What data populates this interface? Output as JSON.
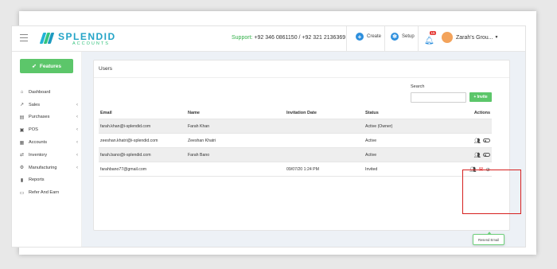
{
  "header": {
    "brand_name": "SPLENDID",
    "brand_sub": "ACCOUNTS",
    "support_label": "Support:",
    "support_numbers": "+92 346 0861150 / +92 321 2136369",
    "create_label": "Create",
    "setup_label": "Setup",
    "notification_count": "15",
    "org_name": "Zarah's Grou...",
    "icons": [
      "menu-icon",
      "plus-icon",
      "gear-icon",
      "bell-icon",
      "chevron-down-icon"
    ]
  },
  "sidebar": {
    "features_label": "Features",
    "items": [
      {
        "label": "Dashboard",
        "icon": "home-icon",
        "has_chevron": false
      },
      {
        "label": "Sales",
        "icon": "chart-icon",
        "has_chevron": true
      },
      {
        "label": "Purchases",
        "icon": "cart-icon",
        "has_chevron": true
      },
      {
        "label": "POS",
        "icon": "pos-icon",
        "has_chevron": true
      },
      {
        "label": "Accounts",
        "icon": "accounts-icon",
        "has_chevron": true
      },
      {
        "label": "Inventory",
        "icon": "inventory-icon",
        "has_chevron": true
      },
      {
        "label": "Manufacturing",
        "icon": "manufacturing-icon",
        "has_chevron": true
      },
      {
        "label": "Reports",
        "icon": "reports-icon",
        "has_chevron": false
      },
      {
        "label": "Refer And Earn",
        "icon": "refer-icon",
        "has_chevron": false
      }
    ]
  },
  "users": {
    "title": "Users",
    "search_label": "Search",
    "search_value": "",
    "invite_label": "+ Invite",
    "columns": [
      "Email",
      "Name",
      "Invitation Date",
      "Status",
      "Actions"
    ],
    "rows": [
      {
        "email": "farah.khan@i-splendid.com",
        "name": "Farah Khan",
        "date": "",
        "status": "Active (Owner)"
      },
      {
        "email": "zeeshan.khatri@i-splendid.com",
        "name": "Zeeshan Khatri",
        "date": "",
        "status": "Active"
      },
      {
        "email": "farah.bano@i-splendid.com",
        "name": "Farah Bano",
        "date": "",
        "status": "Active"
      },
      {
        "email": "farahbano77@gmail.com",
        "name": "",
        "date": "09/07/20 1:24 PM",
        "status": "Invited"
      }
    ],
    "tooltip": "Resend Email",
    "highlight_color": "#d6201f"
  },
  "colors": {
    "brand_blue": "#24a4c7",
    "brand_green": "#33c27c",
    "button_green": "#5cc66a",
    "action_red": "#e02b2b"
  }
}
